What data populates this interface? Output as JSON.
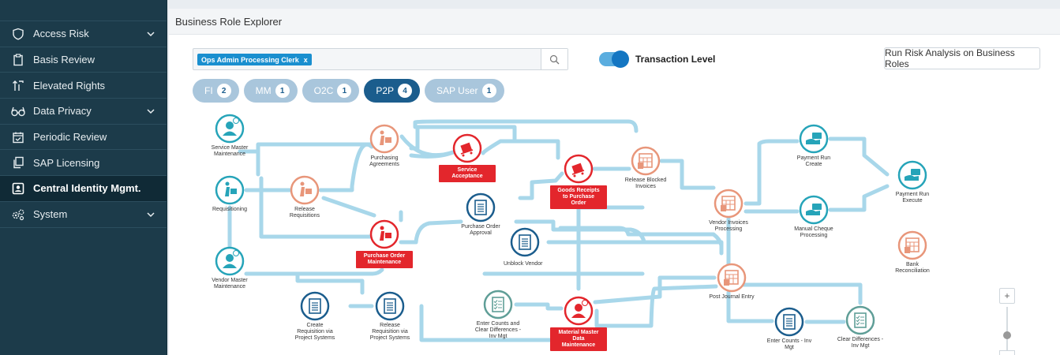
{
  "sidebar": {
    "items": [
      {
        "label": "Access Risk",
        "icon": "shield-icon",
        "chevron": true
      },
      {
        "label": "Basis Review",
        "icon": "clipboard-icon",
        "chevron": false
      },
      {
        "label": "Elevated Rights",
        "icon": "elevated-rights-icon",
        "chevron": false
      },
      {
        "label": "Data Privacy",
        "icon": "glasses-icon",
        "chevron": true
      },
      {
        "label": "Periodic Review",
        "icon": "calendar-check-icon",
        "chevron": false
      },
      {
        "label": "SAP Licensing",
        "icon": "copy-icon",
        "chevron": false
      },
      {
        "label": "Central Identity Mgmt.",
        "icon": "id-card-icon",
        "chevron": false,
        "active": true
      },
      {
        "label": "System",
        "icon": "gears-icon",
        "chevron": true
      }
    ]
  },
  "page": {
    "title": "Business Role Explorer"
  },
  "search": {
    "chip": "Ops Admin Processing Clerk",
    "chip_remove": "x"
  },
  "toggle": {
    "label": "Transaction Level",
    "on": true
  },
  "run_button": "Run Risk Analysis on Business Roles",
  "tabs": [
    {
      "label": "FI",
      "count": "2",
      "active": false
    },
    {
      "label": "MM",
      "count": "1",
      "active": false
    },
    {
      "label": "O2C",
      "count": "1",
      "active": false
    },
    {
      "label": "P2P",
      "count": "4",
      "active": true
    },
    {
      "label": "SAP User",
      "count": "1",
      "active": false
    }
  ],
  "nodes": [
    {
      "id": "service-master",
      "label": "Service Master\nMaintenance",
      "color": "#26a4b9",
      "icon": "user-icon"
    },
    {
      "id": "requisitioning",
      "label": "Requisitioning",
      "color": "#26a4b9",
      "icon": "delivery-icon"
    },
    {
      "id": "vendor-master",
      "label": "Vendor Master\nMaintenance",
      "color": "#26a4b9",
      "icon": "user-icon"
    },
    {
      "id": "release-requisitions",
      "label": "Release\nRequisitions",
      "color": "#e8967a",
      "icon": "delivery-icon"
    },
    {
      "id": "purchasing-agreements",
      "label": "Purchasing\nAgreements",
      "color": "#e8967a",
      "icon": "delivery-icon"
    },
    {
      "id": "purchase-order-maintenance",
      "label": "",
      "badge": "Purchase Order\nMaintenance",
      "color": "#e3262c",
      "icon": "delivery-icon"
    },
    {
      "id": "service-acceptance",
      "label": "",
      "badge": "Service\nAcceptance",
      "color": "#e3262c",
      "icon": "cart-icon"
    },
    {
      "id": "purchase-order-approval",
      "label": "Purchase Order\nApproval",
      "color": "#1b5d8d",
      "icon": "document-icon"
    },
    {
      "id": "unblock-vendor",
      "label": "Unblock Vendor",
      "color": "#1b5d8d",
      "icon": "document-icon"
    },
    {
      "id": "goods-receipts",
      "label": "",
      "badge": "Goods Receipts\nto Purchase\nOrder",
      "color": "#e3262c",
      "icon": "cart-icon"
    },
    {
      "id": "release-blocked-invoices",
      "label": "Release Blocked\nInvoices",
      "color": "#e8967a",
      "icon": "invoice-icon"
    },
    {
      "id": "vendor-invoices",
      "label": "Vendor Invoices\nProcessing",
      "color": "#e8967a",
      "icon": "invoice-icon"
    },
    {
      "id": "payment-run-create",
      "label": "Payment Run\nCreate",
      "color": "#26a4b9",
      "icon": "payment-icon"
    },
    {
      "id": "manual-cheque",
      "label": "Manual Cheque\nProcessing",
      "color": "#26a4b9",
      "icon": "payment-icon"
    },
    {
      "id": "payment-run-execute",
      "label": "Payment Run\nExecute",
      "color": "#26a4b9",
      "icon": "payment-icon"
    },
    {
      "id": "bank-reconciliation",
      "label": "Bank\nReconciliation",
      "color": "#e8967a",
      "icon": "invoice-icon"
    },
    {
      "id": "post-journal-entry",
      "label": "Post Journal Entry",
      "color": "#e8967a",
      "icon": "invoice-icon"
    },
    {
      "id": "create-requisition",
      "label": "Create\nRequisition via\nProject Systems",
      "color": "#1b5d8d",
      "icon": "document-icon"
    },
    {
      "id": "release-requisition-ps",
      "label": "Release\nRequisition via\nProject Systems",
      "color": "#1b5d8d",
      "icon": "document-icon"
    },
    {
      "id": "enter-counts-clear",
      "label": "Enter Counts and\nClear Differences -\nInv Mgt",
      "color": "#5f9e97",
      "icon": "checklist-icon"
    },
    {
      "id": "material-master",
      "label": "",
      "badge": "Material Master\nData\nMaintenance",
      "color": "#e3262c",
      "icon": "user-icon"
    },
    {
      "id": "enter-counts-inv",
      "label": "Enter Counts - Inv\nMgt",
      "color": "#1b5d8d",
      "icon": "document-icon"
    },
    {
      "id": "clear-differences",
      "label": "Clear Differences -\nInv Mgt",
      "color": "#5f9e97",
      "icon": "checklist-icon"
    }
  ],
  "zoom": {
    "plus": "+"
  }
}
